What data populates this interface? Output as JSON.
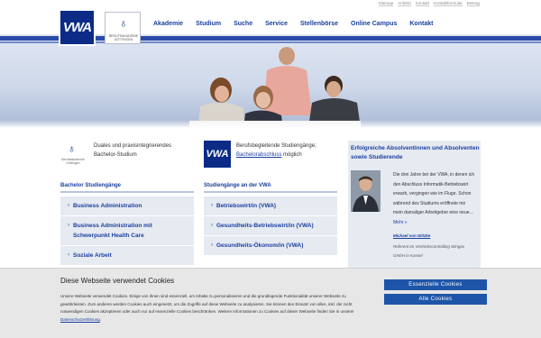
{
  "utility_links": [
    "Sitemap",
    "Anfahrt",
    "Kontakt",
    "Kontaktformular",
    "Beitrag"
  ],
  "logos": {
    "vwa_text": "VWA",
    "ba_text": "BERUFSAKADEMIE GÖTTINGEN"
  },
  "nav": [
    "Akademie",
    "Studium",
    "Suche",
    "Service",
    "Stellenbörse",
    "Online Campus",
    "Kontakt"
  ],
  "intro": {
    "left_text": "Duales und praxisintegrierendes Bachelor-Studium",
    "left_logo_text": "Berufsakademie Göttingen",
    "right_text_before": "Berufsbegleitende Studiengänge; ",
    "right_link": "Bachelorabschluss",
    "right_text_after": " möglich",
    "right_logo_text": "VWA"
  },
  "bachelor": {
    "title": "Bachelor Studiengänge",
    "items": [
      "Business Administration",
      "Business Administration mit Schwerpunkt Health Care",
      "Soziale Arbeit"
    ]
  },
  "vwa_courses": {
    "title": "Studiengänge an der VWA",
    "items": [
      "Betriebswirt/in (VWA)",
      "Gesundheits-Betriebswirt/in (VWA)",
      "Gesundheits-Ökonom/in (VWA)"
    ]
  },
  "testimonial": {
    "title": "Erfolgreiche Absolventinnen und Absolventen sowie Studierende",
    "quote": "Die drei Jahre bei der VWA, in denen ich den Abschluss Informatik-Betriebswirt erwarb, vergingen wie im Fluge. Schon während des Studiums eröffnete mir mein damaliger Arbeitgeber eine neue…",
    "more": "Mehr »",
    "name": "Michael von Witzke",
    "role": "Referent im Vertriebscontrolling Wingas GmbH in Kassel"
  },
  "cookie": {
    "title": "Diese Webseite verwendet Cookies",
    "text_before": "Unsere Webseite verwendet Cookies. Einige von ihnen sind essenziell, um Inhalte zu personalisieren und die grundlegende Funktionalität unserer Webseite zu gewährleisten. Zum anderen werden Cookies auch eingesetzt, um die Zugriffe auf diese Webseite zu analysieren. Sie können den Einsatz von allen, inkl. der nicht notwendigen Cookies akzeptieren oder auch nur auf essenzielle Cookies beschränken. Weitere Informationen zu Cookies auf dieser Webseite finden Sie in unserer ",
    "link": "Datenschutzerklärung",
    "text_after": ".",
    "btn_essential": "Essenzielle Cookies",
    "btn_all": "Alle Cookies"
  },
  "colors": {
    "brand_blue": "#0b2b86",
    "link_blue": "#1a3fa0",
    "button_blue": "#1e55a8",
    "panel_gray": "#e6eaf1"
  }
}
